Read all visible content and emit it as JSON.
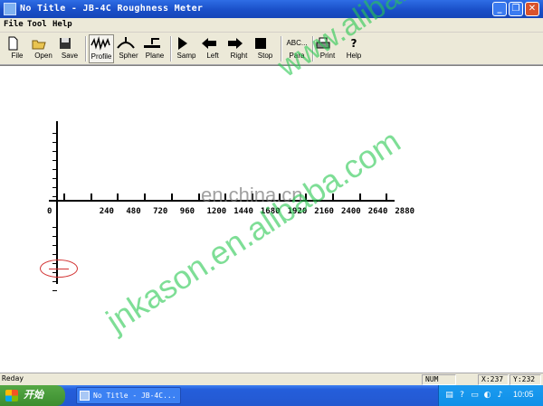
{
  "window": {
    "title": "No Title - JB-4C Roughness Meter",
    "minimize_glyph": "_",
    "maximize_glyph": "❐",
    "close_glyph": "✕"
  },
  "menu": {
    "items": [
      "File",
      "Tool",
      "Help"
    ]
  },
  "toolbar": {
    "buttons": [
      {
        "label": "File",
        "icon": "new-file-icon"
      },
      {
        "label": "Open",
        "icon": "open-folder-icon"
      },
      {
        "label": "Save",
        "icon": "save-disk-icon"
      },
      {
        "label": "Profile",
        "icon": "profile-icon"
      },
      {
        "label": "Spher",
        "icon": "sphere-icon"
      },
      {
        "label": "Plane",
        "icon": "plane-icon"
      },
      {
        "label": "Samp",
        "icon": "play-icon"
      },
      {
        "label": "Left",
        "icon": "arrow-left-icon"
      },
      {
        "label": "Right",
        "icon": "arrow-right-icon"
      },
      {
        "label": "Stop",
        "icon": "stop-icon"
      },
      {
        "label": "Para",
        "icon": "abc-icon",
        "icon_text": "ABC..."
      },
      {
        "label": "Print",
        "icon": "printer-icon"
      },
      {
        "label": "Help",
        "icon": "help-icon",
        "icon_text": "?"
      }
    ],
    "active": "Profile"
  },
  "plot": {
    "x_ticks": [
      "0",
      "240",
      "480",
      "720",
      "960",
      "1200",
      "1440",
      "1680",
      "1920",
      "2160",
      "2400",
      "2640",
      "2880"
    ]
  },
  "watermarks": {
    "top": "www.alibaba.com",
    "center": "en.china.cn",
    "bottom": "jnkason.en.alibaba.com"
  },
  "statusbar": {
    "message": "Reday",
    "num": "NUM",
    "x": "X:237",
    "y": "Y:232"
  },
  "taskbar": {
    "start_label": "开始",
    "task_label": "No Title - JB-4C...",
    "clock": "10:05"
  },
  "colors": {
    "titlebar": "#1a4fc8",
    "ellipse": "#d23030",
    "watermark": "#28c850"
  }
}
